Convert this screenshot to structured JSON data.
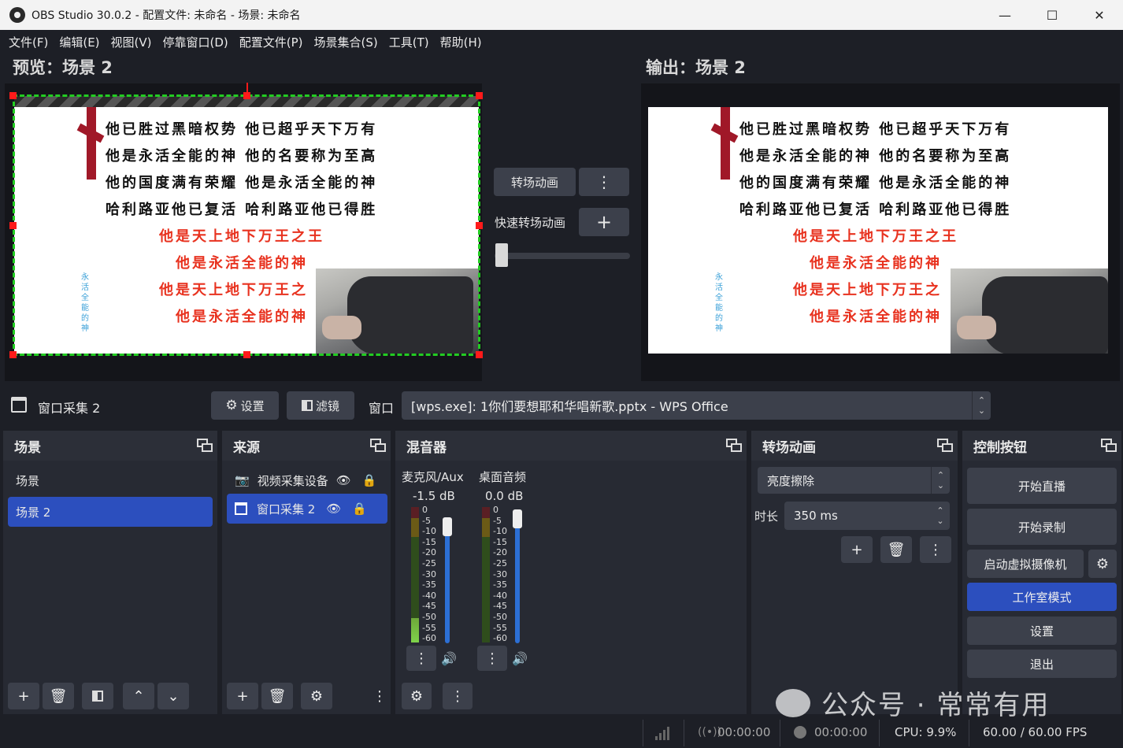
{
  "window": {
    "title": "OBS Studio 30.0.2 - 配置文件: 未命名 - 场景: 未命名"
  },
  "menu": [
    "文件(F)",
    "编辑(E)",
    "视图(V)",
    "停靠窗口(D)",
    "配置文件(P)",
    "场景集合(S)",
    "工具(T)",
    "帮助(H)"
  ],
  "preview": {
    "title": "预览：场景 2"
  },
  "output": {
    "title": "输出：场景 2"
  },
  "slide": {
    "black_lines": [
      "他已胜过黑暗权势 他已超乎天下万有",
      "他是永活全能的神 他的名要称为至高",
      "他的国度满有荣耀 他是永活全能的神",
      "哈利路亚他已复活 哈利路亚他已得胜"
    ],
    "red_lines": [
      "他是天上地下万王之王",
      "他是永活全能的神",
      "他是天上地下万王之",
      "他是永活全能的神"
    ],
    "vertical_text": "永活全能的神"
  },
  "transition_controls": {
    "transition_button": "转场动画",
    "quick_transition_label": "快速转场动画"
  },
  "source_toolbar": {
    "source_name": "窗口采集 2",
    "settings": "设置",
    "filters": "滤镜",
    "window_label": "窗口",
    "window_value": "[wps.exe]: 1你们要想耶和华唱新歌.pptx - WPS Office"
  },
  "scenes": {
    "title": "场景",
    "items": [
      "场景",
      "场景 2"
    ]
  },
  "sources": {
    "title": "来源",
    "items": [
      "视频采集设备",
      "窗口采集 2"
    ]
  },
  "mixer": {
    "title": "混音器",
    "channels": [
      {
        "name": "麦克风/Aux",
        "db": "-1.5 dB",
        "level": 0.18,
        "volume": 0.93
      },
      {
        "name": "桌面音频",
        "db": "0.0 dB",
        "level": 0.0,
        "volume": 1.0
      }
    ],
    "ticks": [
      "0",
      "-5",
      "-10",
      "-15",
      "-20",
      "-25",
      "-30",
      "-35",
      "-40",
      "-45",
      "-50",
      "-55",
      "-60"
    ]
  },
  "transitions": {
    "title": "转场动画",
    "selected": "亮度擦除",
    "duration_label": "时长",
    "duration_value": "350 ms"
  },
  "controls": {
    "title": "控制按钮",
    "start_stream": "开始直播",
    "start_record": "开始录制",
    "virtual_cam": "启动虚拟摄像机",
    "studio_mode": "工作室模式",
    "settings": "设置",
    "exit": "退出"
  },
  "status": {
    "stream_time": "00:00:00",
    "record_time": "00:00:00",
    "cpu": "CPU: 9.9%",
    "fps": "60.00 / 60.00 FPS"
  },
  "watermark": "公众号 · 常常有用",
  "colors": {
    "accent": "#2c4fbe",
    "bg": "#1d1f26",
    "panel": "#272a33",
    "button": "#3c404b"
  }
}
